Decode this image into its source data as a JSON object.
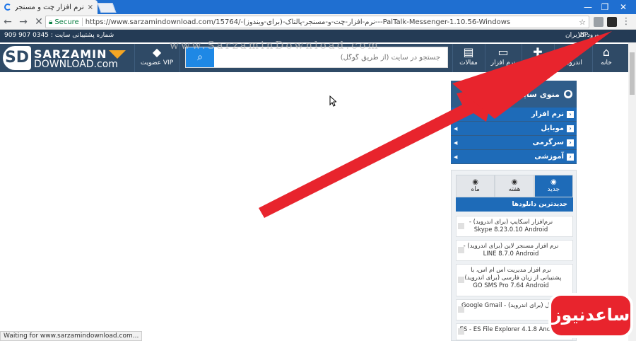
{
  "browser": {
    "tab_title": "نرم افزار چت و مسنجر پالتاک",
    "tab_close": "×",
    "window_minimize": "—",
    "window_restore": "❐",
    "window_close": "✕",
    "back": "←",
    "forward": "→",
    "stop": "✕",
    "secure_label": "Secure",
    "url": "https://www.sarzamindownload.com/15764/-نرم-افزار-چت-و-مسنجر-پالتاک-(برای-ویندوز)---PalTalk-Messenger-1.10.56-Windows",
    "star": "☆",
    "menu": "⋮",
    "status_text": "Waiting for www.sarzamindownload.com..."
  },
  "topbar": {
    "support_phone": "شماره پشتیبانی سایت : 0345 907 909",
    "login": "ورود کاربران",
    "vip": "VIP"
  },
  "watermark": "www.SarzaminDownload.com",
  "header": {
    "logo_line1": "SARZAMIN",
    "logo_line2": "DOWNLOAD.com",
    "logo_mark": "SD",
    "vip_label": "عضویت VIP",
    "search_placeholder": "جستجو در سایت (از طریق گوگل)",
    "nav": [
      {
        "label": "خانه",
        "icon": "home-icon"
      },
      {
        "label": "اندروید",
        "icon": "android-icon"
      },
      {
        "label": "نرم افزار",
        "icon": "gamepad-icon"
      },
      {
        "label": "",
        "icon": "monitor-icon"
      },
      {
        "label": "مقالات",
        "icon": "book-icon"
      }
    ]
  },
  "menu": {
    "title": "منوی سایت",
    "items": [
      "نرم افزار",
      "موبایل",
      "سرگرمی",
      "آموزشی"
    ]
  },
  "downloads": {
    "tabs": [
      "جدید",
      "هفته",
      "ماه"
    ],
    "heading": "جدیدترین دانلودها",
    "items": [
      "نرم‌افزار اسکایپ (برای اندروید) - Skype 8.23.0.10 Android",
      "نرم افزار مسنجر لاین (برای اندروید) - LINE 8.7.0 Android",
      "نرم افزار مدیریت اس ام اس، با پشتیبانی از زبان فارسی (برای اندروید) - GO SMS Pro 7.64 Android",
      "جیمیل (برای اندروید) - Google Gmail",
      "ES - ES File Explorer 4.1.8 Android"
    ]
  },
  "badge": "ساعدنیوز",
  "colors": {
    "arrow": "#e8242d",
    "header": "#2f4a66",
    "accent": "#1e6bb8"
  }
}
